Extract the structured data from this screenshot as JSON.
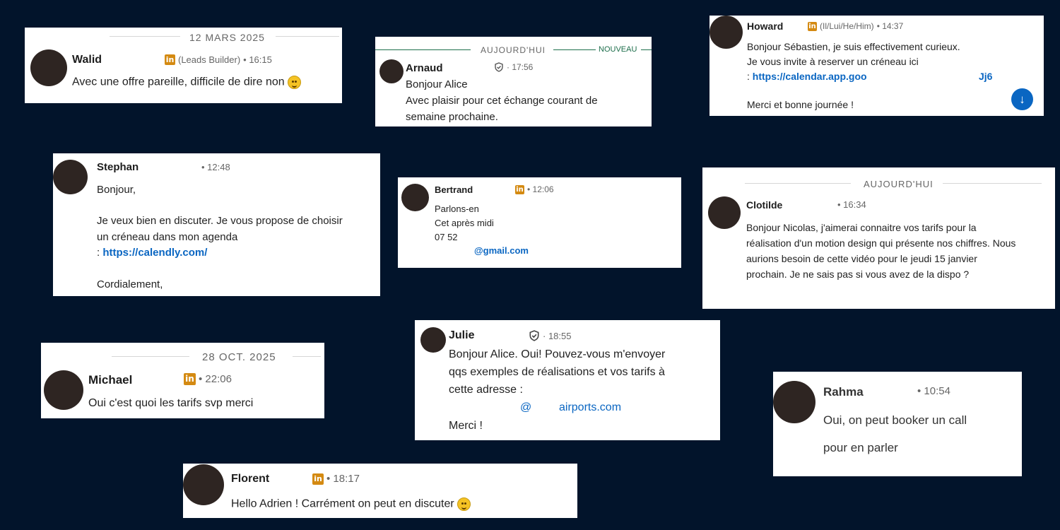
{
  "messages": [
    {
      "name": "Walid",
      "headline": "(Leads Builder)",
      "time": "• 16:15",
      "date": "12 MARS 2025",
      "lines": [
        "Avec une offre pareille, difficile de dire non"
      ]
    },
    {
      "name": "Arnaud",
      "time": "· 17:56",
      "date": "AUJOURD'HUI",
      "badge": "NOUVEAU",
      "lines": [
        "Bonjour Alice",
        "Avec plaisir pour cet échange courant de",
        "semaine prochaine."
      ]
    },
    {
      "name": "Howard",
      "headline": "(Il/Lui/He/Him)",
      "time": "• 14:37",
      "lines": [
        "Bonjour Sébastien, je suis effectivement curieux.",
        "Je vous invite à reserver un créneau ici"
      ],
      "link_prefix": ": ",
      "link": "https://calendar.app.goo",
      "link_tail": "Jj6",
      "closing": "Merci et bonne journée !"
    },
    {
      "name": "Stephan",
      "time": "• 12:48",
      "lines": [
        "Bonjour,",
        "Je veux bien en discuter. Je vous propose de choisir",
        "un créneau dans mon agenda"
      ],
      "link_prefix": ": ",
      "link": "https://calendly.com/",
      "closing": "Cordialement,"
    },
    {
      "name": "Bertrand",
      "time": "• 12:06",
      "lines": [
        "Parlons-en",
        "Cet après midi",
        "07 52"
      ],
      "email": "@gmail.com"
    },
    {
      "name": "Clotilde",
      "time": "• 16:34",
      "date": "AUJOURD'HUI",
      "lines": [
        "Bonjour Nicolas, j'aimerai connaitre vos tarifs pour la",
        "réalisation d'un motion design qui présente nos chiffres. Nous",
        "aurions besoin de cette vidéo pour le jeudi 15 janvier",
        "prochain. Je ne sais pas si vous avez de la dispo ?"
      ]
    },
    {
      "name": "Michael",
      "time": "• 22:06",
      "date": "28 OCT. 2025",
      "lines": [
        "Oui c'est quoi les tarifs svp merci"
      ]
    },
    {
      "name": "Julie",
      "time": "· 18:55",
      "lines": [
        "Bonjour Alice. Oui! Pouvez-vous m'envoyer",
        "qqs exemples de réalisations et vos tarifs à",
        "cette adresse :"
      ],
      "email_at": "@",
      "email_domain": "airports.com",
      "closing": "Merci !"
    },
    {
      "name": "Rahma",
      "time": "• 10:54",
      "lines": [
        "Oui, on peut booker un call",
        "pour en parler"
      ]
    },
    {
      "name": "Florent",
      "time": "• 18:17",
      "lines": [
        "Hello Adrien ! Carrément on peut en discuter"
      ]
    }
  ],
  "icons": {
    "linkedin": "in",
    "shield": "shield-icon",
    "emoji": "winking-face-icon",
    "down": "↓"
  }
}
